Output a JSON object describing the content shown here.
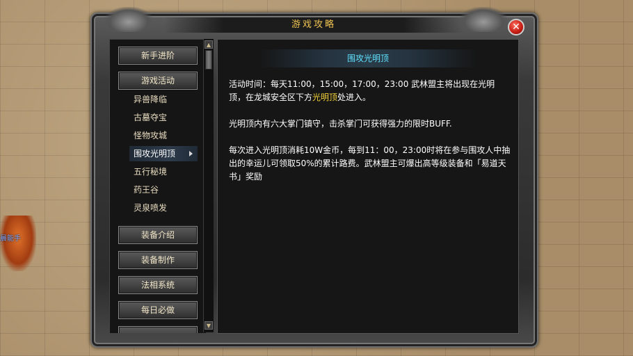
{
  "window": {
    "title": "游戏攻略",
    "close_label": "✕"
  },
  "background": {
    "npc_name": "晨能手"
  },
  "sidebar": {
    "buttons_top": [
      {
        "label": "新手进阶"
      },
      {
        "label": "游戏活动"
      }
    ],
    "sub_items": [
      {
        "label": "异兽降临"
      },
      {
        "label": "古墓夺宝"
      },
      {
        "label": "怪物攻城"
      },
      {
        "label": "围攻光明顶",
        "active": true
      },
      {
        "label": "五行秘境"
      },
      {
        "label": "药王谷"
      },
      {
        "label": "灵泉喷发"
      }
    ],
    "buttons_bottom": [
      {
        "label": "装备介绍"
      },
      {
        "label": "装备制作"
      },
      {
        "label": "法相系统"
      },
      {
        "label": "每日必做"
      }
    ]
  },
  "content": {
    "title": "围攻光明顶",
    "p1_a": "活动时间：每天11:00，15:00，17:00，23:00 武林盟主将出现在光明顶，在龙城安全区下方",
    "p1_hl": "光明顶",
    "p1_b": "处进入。",
    "p2": "光明顶内有六大掌门镇守，击杀掌门可获得强力的限时BUFF.",
    "p3": "每次进入光明顶消耗10W金币，每到11：00，23:00时将在参与围攻人中抽出的幸运儿可领取50%的累计路费。武林盟主可爆出高等级装备和「易道天书」奖励"
  },
  "colors": {
    "title_gold": "#f0c352",
    "content_title_cyan": "#5fe3ff",
    "highlight_yellow": "#f0d03a"
  }
}
